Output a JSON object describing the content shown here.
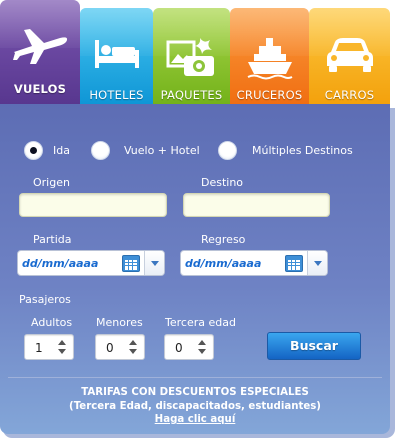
{
  "tabs": [
    {
      "label": "VUELOS",
      "icon": "airplane-icon",
      "active": true,
      "color": "#6a48a3"
    },
    {
      "label": "HOTELES",
      "icon": "bed-icon",
      "active": false,
      "color": "#1fa6e0"
    },
    {
      "label": "PAQUETES",
      "icon": "photos-camera-icon",
      "active": false,
      "color": "#8cc43a"
    },
    {
      "label": "CRUCEROS",
      "icon": "ship-icon",
      "active": false,
      "color": "#f7852a"
    },
    {
      "label": "CARROS",
      "icon": "car-icon",
      "active": false,
      "color": "#f9b62a"
    }
  ],
  "trip_type": {
    "options": [
      "Ida",
      "Vuelo + Hotel",
      "Múltiples Destinos"
    ],
    "selected": "Ida"
  },
  "origin": {
    "label": "Origen",
    "value": ""
  },
  "destination": {
    "label": "Destino",
    "value": ""
  },
  "departure": {
    "label": "Partida",
    "value": "dd/mm/aaaa"
  },
  "return": {
    "label": "Regreso",
    "value": "dd/mm/aaaa"
  },
  "passengers": {
    "label": "Pasajeros",
    "adults": {
      "label": "Adultos",
      "value": "1"
    },
    "minors": {
      "label": "Menores",
      "value": "0"
    },
    "seniors": {
      "label": "Tercera edad",
      "value": "0"
    }
  },
  "search_button": "Buscar",
  "promo": {
    "title": "TARIFAS CON DESCUENTOS ESPECIALES",
    "subtitle": "(Tercera Edad, discapacitados, estudiantes)",
    "link": "Haga clic aquí"
  },
  "colors": {
    "panel": "#6677bd",
    "accent_button": "#1f7ad6",
    "date_text": "#1a6bd0"
  }
}
